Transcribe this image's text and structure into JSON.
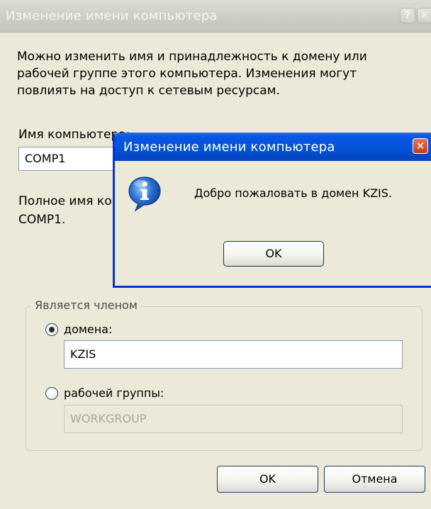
{
  "background_dialog": {
    "title": "Изменение имени компьютера",
    "help_glyph": "?",
    "close_glyph": "✕",
    "description": "Можно изменить имя и принадлежность к домену или рабочей группе этого компьютера. Изменения могут повлиять на доступ к сетевым ресурсам.",
    "computer_name_label": "Имя компьютера:",
    "computer_name_value": "COMP1",
    "full_name_label": "Полное имя компьютера:",
    "full_name_value": "COMP1.",
    "member_of": {
      "legend": "Является членом",
      "domain_label": "домена:",
      "domain_value": "KZIS",
      "domain_selected": true,
      "workgroup_label": "рабочей группы:",
      "workgroup_value": "WORKGROUP",
      "workgroup_selected": false
    },
    "ok_label": "OK",
    "cancel_label": "Отмена"
  },
  "message_box": {
    "title": "Изменение имени компьютера",
    "close_glyph": "✕",
    "icon": "info-icon",
    "message": "Добро пожаловать в домен KZIS.",
    "ok_label": "OK"
  },
  "colors": {
    "dialog_bg": "#ece9d8",
    "active_titlebar": "#0355d8",
    "inactive_titlebar": "#cfcec6",
    "input_border": "#7f9db9",
    "info_icon_blue": "#2a6ecd"
  }
}
